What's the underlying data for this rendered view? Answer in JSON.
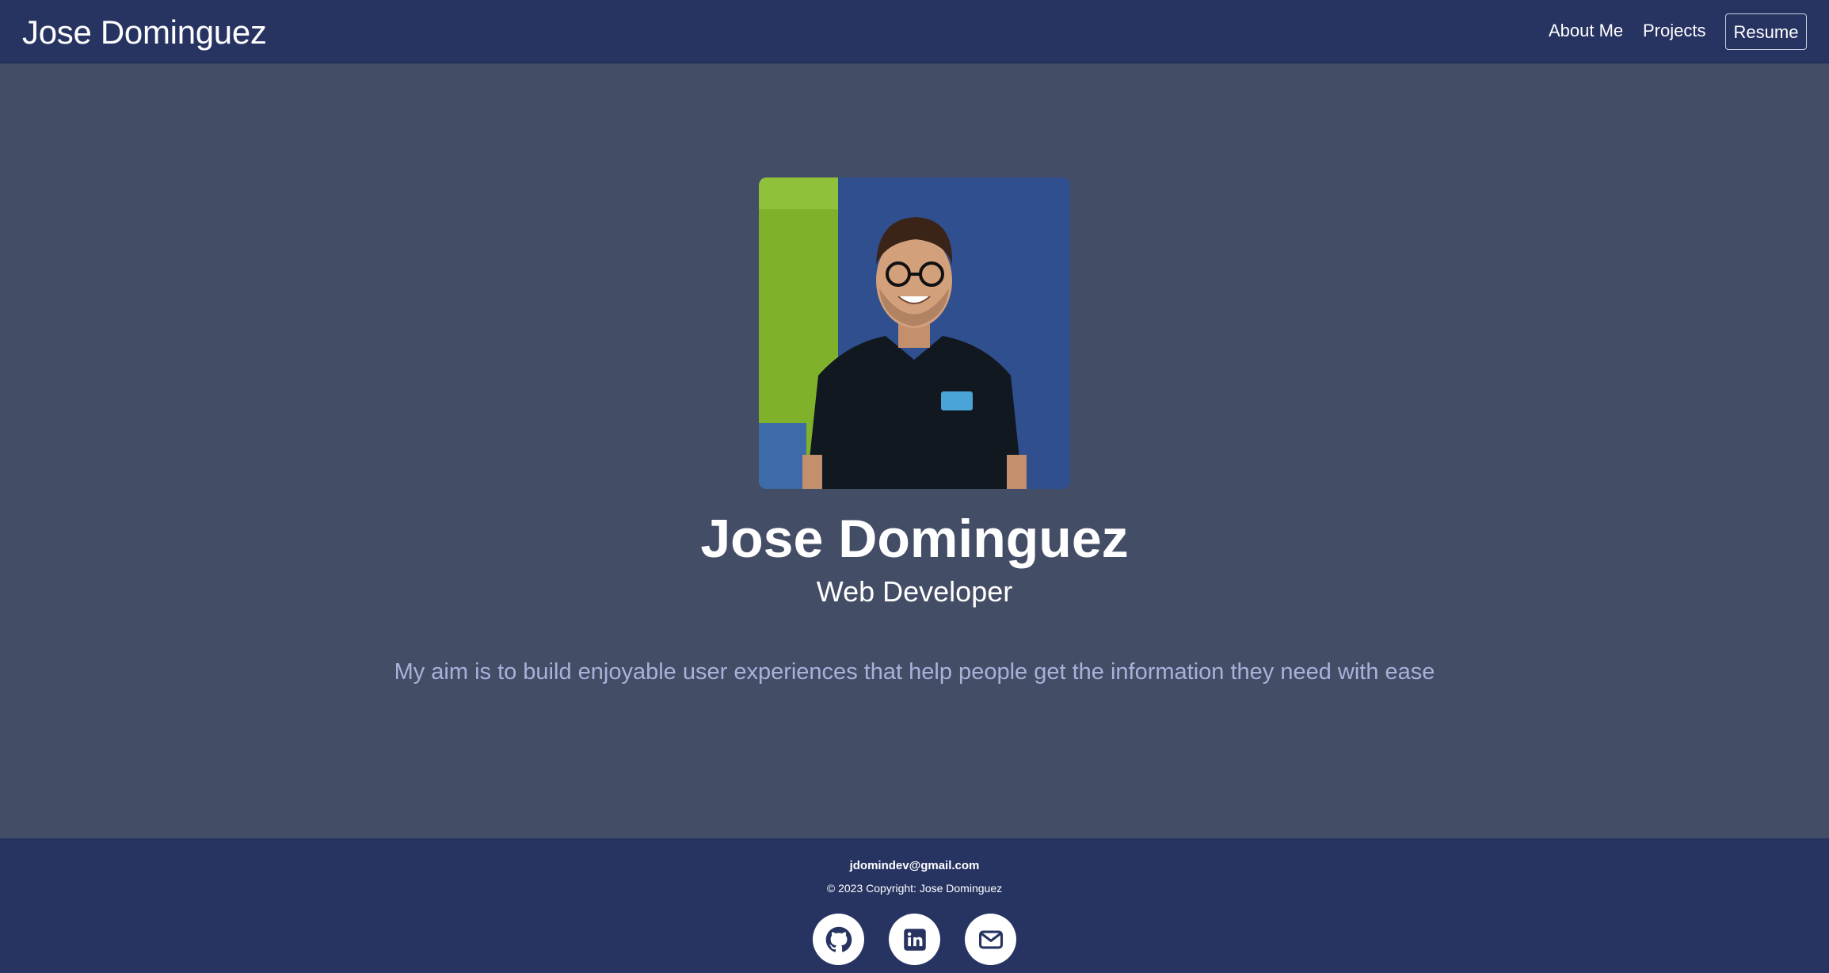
{
  "navbar": {
    "brand": "Jose Dominguez",
    "links": [
      {
        "label": "About Me"
      },
      {
        "label": "Projects"
      }
    ],
    "resume_label": "Resume"
  },
  "hero": {
    "name": "Jose Dominguez",
    "role": "Web Developer",
    "tagline": "My aim is to build enjoyable user experiences that help people get the information they need with ease"
  },
  "footer": {
    "email": "jdomindev@gmail.com",
    "copyright": "© 2023 Copyright: Jose Dominguez",
    "social": [
      {
        "icon": "github-icon"
      },
      {
        "icon": "linkedin-icon"
      },
      {
        "icon": "envelope-icon"
      }
    ]
  },
  "colors": {
    "navbar_bg": "#273462",
    "page_bg": "#444d66",
    "tagline": "#a8b2d9"
  }
}
